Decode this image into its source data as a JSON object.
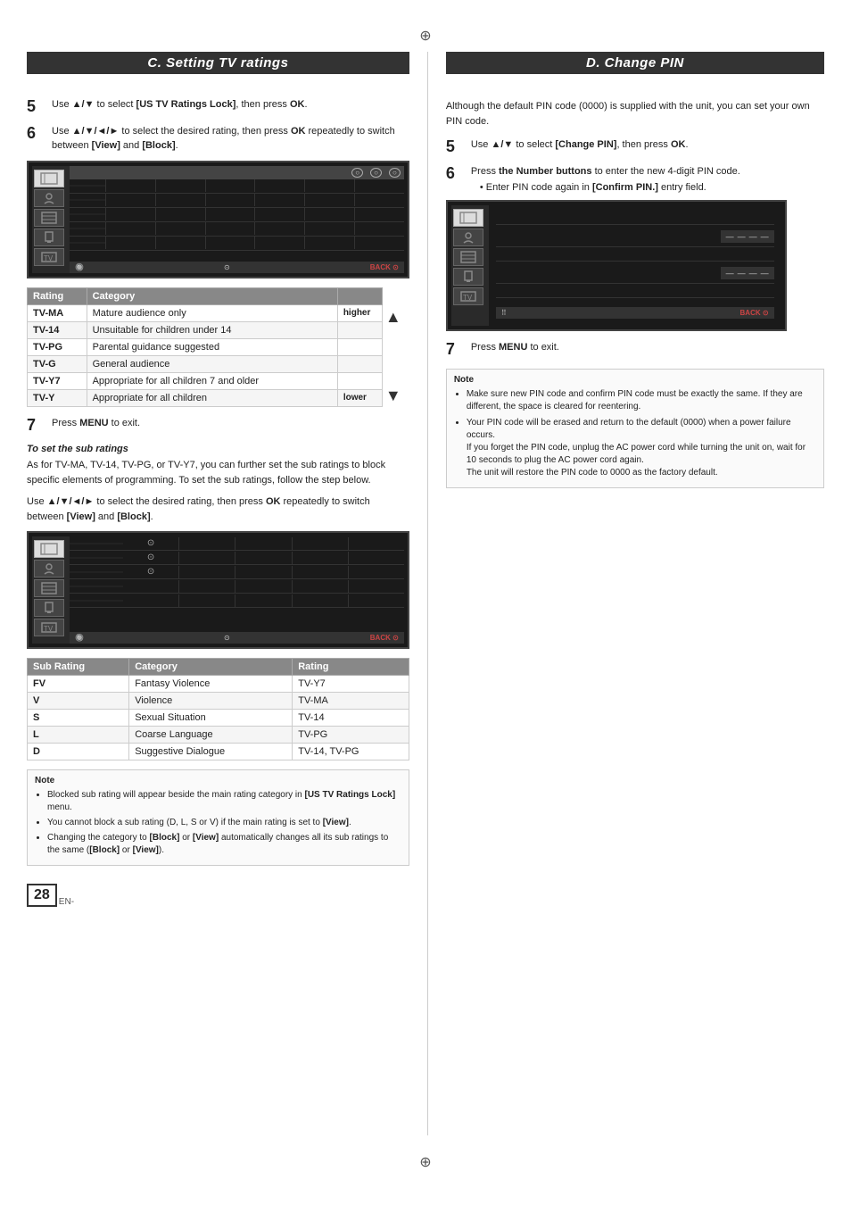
{
  "page": {
    "number": "28",
    "lang": "EN-"
  },
  "left": {
    "title": "C. Setting TV ratings",
    "step5": {
      "num": "5",
      "text": "Use ▲/▼ to select [US TV Ratings Lock], then press OK."
    },
    "step6": {
      "num": "6",
      "text": "Use ▲/▼/◄/► to select the desired rating, then press OK repeatedly to switch between [View] and [Block]."
    },
    "step7": {
      "num": "7",
      "text": "Press MENU to exit."
    },
    "rating_table": {
      "col1": "Rating",
      "col2": "Category",
      "rows": [
        {
          "rating": "TV-MA",
          "category": "Mature audience only",
          "note": "higher"
        },
        {
          "rating": "TV-14",
          "category": "Unsuitable for children under 14",
          "note": ""
        },
        {
          "rating": "TV-PG",
          "category": "Parental guidance suggested",
          "note": ""
        },
        {
          "rating": "TV-G",
          "category": "General audience",
          "note": ""
        },
        {
          "rating": "TV-Y7",
          "category": "Appropriate for all children 7 and older",
          "note": ""
        },
        {
          "rating": "TV-Y",
          "category": "Appropriate for all children",
          "note": "lower"
        }
      ]
    },
    "higher_label": "higher",
    "lower_label": "lower",
    "sub_section_title": "To set the sub ratings",
    "sub_intro": "As for TV-MA, TV-14, TV-PG, or TV-Y7, you can further set the sub ratings to block specific elements of programming. To set the sub ratings, follow the step below.",
    "use_text": "Use ▲/▼/◄/► to select the desired rating, then press OK repeatedly to switch between [View] and [Block].",
    "sub_table": {
      "col1": "Sub Rating",
      "col2": "Category",
      "col3": "Rating",
      "rows": [
        {
          "sub": "FV",
          "category": "Fantasy Violence",
          "rating": "TV-Y7"
        },
        {
          "sub": "V",
          "category": "Violence",
          "rating": "TV-MA"
        },
        {
          "sub": "S",
          "category": "Sexual Situation",
          "rating": "TV-14"
        },
        {
          "sub": "L",
          "category": "Coarse Language",
          "rating": "TV-PG"
        },
        {
          "sub": "D",
          "category": "Suggestive Dialogue",
          "rating": "TV-14, TV-PG"
        }
      ]
    },
    "note": {
      "title": "Note",
      "items": [
        "Blocked sub rating will appear beside the main rating category in [US TV Ratings Lock] menu.",
        "You cannot block a sub rating (D, L, S or V) if the main rating is set to [View].",
        "Changing the category to [Block] or [View] automatically changes all its sub ratings to the same ([Block] or [View])."
      ]
    }
  },
  "right": {
    "title": "D. Change PIN",
    "intro": "Although the default PIN code (0000) is supplied with the unit, you can set your own PIN code.",
    "step5": {
      "num": "5",
      "text": "Use ▲/▼ to select [Change PIN], then press OK."
    },
    "step6": {
      "num": "6",
      "text": "Press the Number buttons to enter the new 4-digit PIN code."
    },
    "step6_bullet": "Enter PIN code again in [Confirm PIN.] entry field.",
    "step7": {
      "num": "7",
      "text": "Press MENU to exit."
    },
    "note": {
      "title": "Note",
      "items": [
        "Make sure new PIN code and confirm PIN code must be exactly the same. If they are different, the space is cleared for reentering.",
        "Your PIN code will be erased and return to the default (0000) when a power failure occurs. If you forget the PIN code, unplug the AC power cord while turning the unit on, wait for 10 seconds to plug the AC power cord again. The unit will restore the PIN code to 0000 as the factory default."
      ]
    }
  }
}
